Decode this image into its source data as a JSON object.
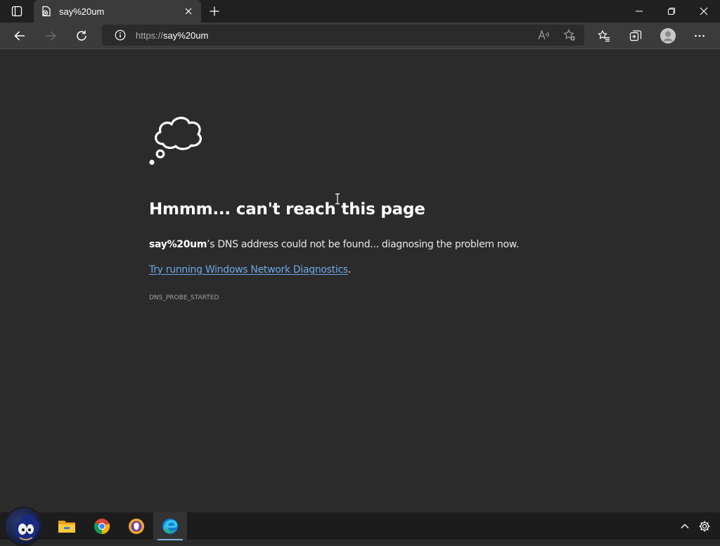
{
  "window": {
    "tab_title": "say%20um"
  },
  "address_bar": {
    "url_scheme": "https://",
    "url_host": "say%20um"
  },
  "error_page": {
    "heading": "Hmmm... can't reach this page",
    "host_bold": "say%20um",
    "dns_message_suffix": "’s DNS address could not be found... diagnosing the problem now.",
    "diagnostics_link": "Try running Windows Network Diagnostics",
    "diagnostics_period": ".",
    "error_code": "DNS_PROBE_STARTED"
  },
  "icons": {
    "tab_actions": "tab-actions-icon",
    "favicon": "page-error-icon",
    "tab_close": "close-icon",
    "new_tab": "plus-icon",
    "minimize": "minimize-icon",
    "restore": "restore-icon",
    "close_window": "close-icon",
    "back": "arrow-left-icon",
    "forward": "arrow-right-icon",
    "refresh": "refresh-icon",
    "site_info": "info-icon",
    "read_aloud": "read-aloud-icon",
    "add_favorite": "star-add-icon",
    "favorites": "favorites-icon",
    "collections": "collections-icon",
    "profile": "profile-icon",
    "more": "ellipsis-icon",
    "thought_cloud": "thought-cloud-icon",
    "file_explorer": "folder-icon",
    "chrome": "chrome-icon",
    "brave": "brave-icon",
    "edge": "edge-icon",
    "tray_chevron": "chevron-up-icon",
    "tray_settings": "gear-icon"
  },
  "colors": {
    "page_bg": "#2b2b2b",
    "link": "#6fa8e6",
    "titlebar": "#202020",
    "toolbar": "#3b3b3b"
  }
}
